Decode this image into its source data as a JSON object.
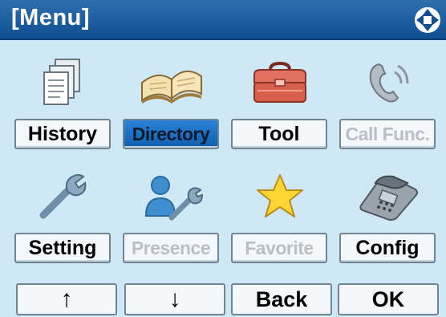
{
  "header": {
    "title": "[Menu]",
    "nav_icon": "four-way-navigation-icon"
  },
  "colors": {
    "header": "#1a5c9f",
    "background": "#cfe8f6",
    "selected": "#1d72c4",
    "disabled_text": "#b8c0c6"
  },
  "menu": [
    {
      "label": "History",
      "icon": "history-documents-icon",
      "state": "normal"
    },
    {
      "label": "Directory",
      "icon": "directory-book-icon",
      "state": "selected"
    },
    {
      "label": "Tool",
      "icon": "toolbox-icon",
      "state": "normal"
    },
    {
      "label": "Call Func.",
      "icon": "call-function-handset-icon",
      "state": "disabled"
    },
    {
      "label": "Setting",
      "icon": "wrench-icon",
      "state": "normal"
    },
    {
      "label": "Presence",
      "icon": "presence-person-wrench-icon",
      "state": "disabled"
    },
    {
      "label": "Favorite",
      "icon": "star-icon",
      "state": "disabled"
    },
    {
      "label": "Config",
      "icon": "desk-phone-icon",
      "state": "normal"
    }
  ],
  "softkeys": [
    {
      "label": "↑",
      "name": "up"
    },
    {
      "label": "↓",
      "name": "down"
    },
    {
      "label": "Back",
      "name": "back"
    },
    {
      "label": "OK",
      "name": "ok"
    }
  ]
}
